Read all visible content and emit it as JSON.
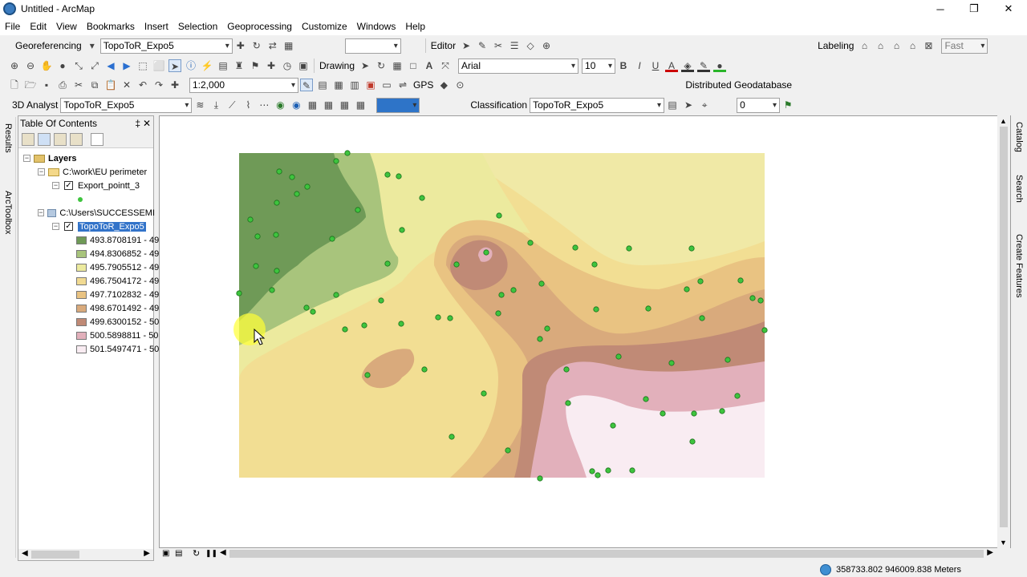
{
  "window": {
    "title": "Untitled - ArcMap",
    "minimize": "─",
    "maximize": "❐",
    "close": "✕"
  },
  "menu": [
    "File",
    "Edit",
    "View",
    "Bookmarks",
    "Insert",
    "Selection",
    "Geoprocessing",
    "Customize",
    "Windows",
    "Help"
  ],
  "toolbar1": {
    "georeferencing": "Georeferencing",
    "layer_combo": "TopoToR_Expo5",
    "editor": "Editor",
    "labeling": "Labeling",
    "fast": "Fast"
  },
  "toolbar2": {
    "drawing": "Drawing",
    "font": "Arial",
    "size": "10",
    "bold": "B",
    "italic": "I",
    "underline": "U",
    "text_tool": "A"
  },
  "toolbar3": {
    "scale": "1:2,000",
    "gps": "GPS",
    "distributed": "Distributed Geodatabase"
  },
  "toolbar4": {
    "analyst3d": "3D Analyst",
    "layer_combo": "TopoToR_Expo5",
    "classification": "Classification",
    "layer_combo2": "TopoToR_Expo5",
    "value": "0"
  },
  "left_tabs": [
    "Results",
    "ArcToolbox"
  ],
  "right_tabs": [
    "Catalog",
    "Search",
    "Create Features"
  ],
  "toc": {
    "title": "Table Of Contents",
    "pin": "‡",
    "close": "✕",
    "root": "Layers",
    "group1": "C:\\work\\EU perimeter",
    "layer1": "Export_pointt_3",
    "group2": "C:\\Users\\SUCCESSEMI",
    "layer2": "TopoToR_Expo5",
    "classes": [
      {
        "label": "493.8708191 - 49",
        "color": "#6f9a57"
      },
      {
        "label": "494.8306852 - 49",
        "color": "#a8c47c"
      },
      {
        "label": "495.7905512 - 49",
        "color": "#ecea9e"
      },
      {
        "label": "496.7504172 - 49",
        "color": "#f1da92"
      },
      {
        "label": "497.7102832 - 49",
        "color": "#e9c382"
      },
      {
        "label": "498.6701492 - 49",
        "color": "#d9aa7c"
      },
      {
        "label": "499.6300152 - 50",
        "color": "#c08a76"
      },
      {
        "label": "500.5898811 - 50",
        "color": "#e2b0bb"
      },
      {
        "label": "501.5497471 - 50",
        "color": "#f9ecf2"
      }
    ]
  },
  "status": {
    "coords": "358733.802 946009.838 Meters"
  }
}
